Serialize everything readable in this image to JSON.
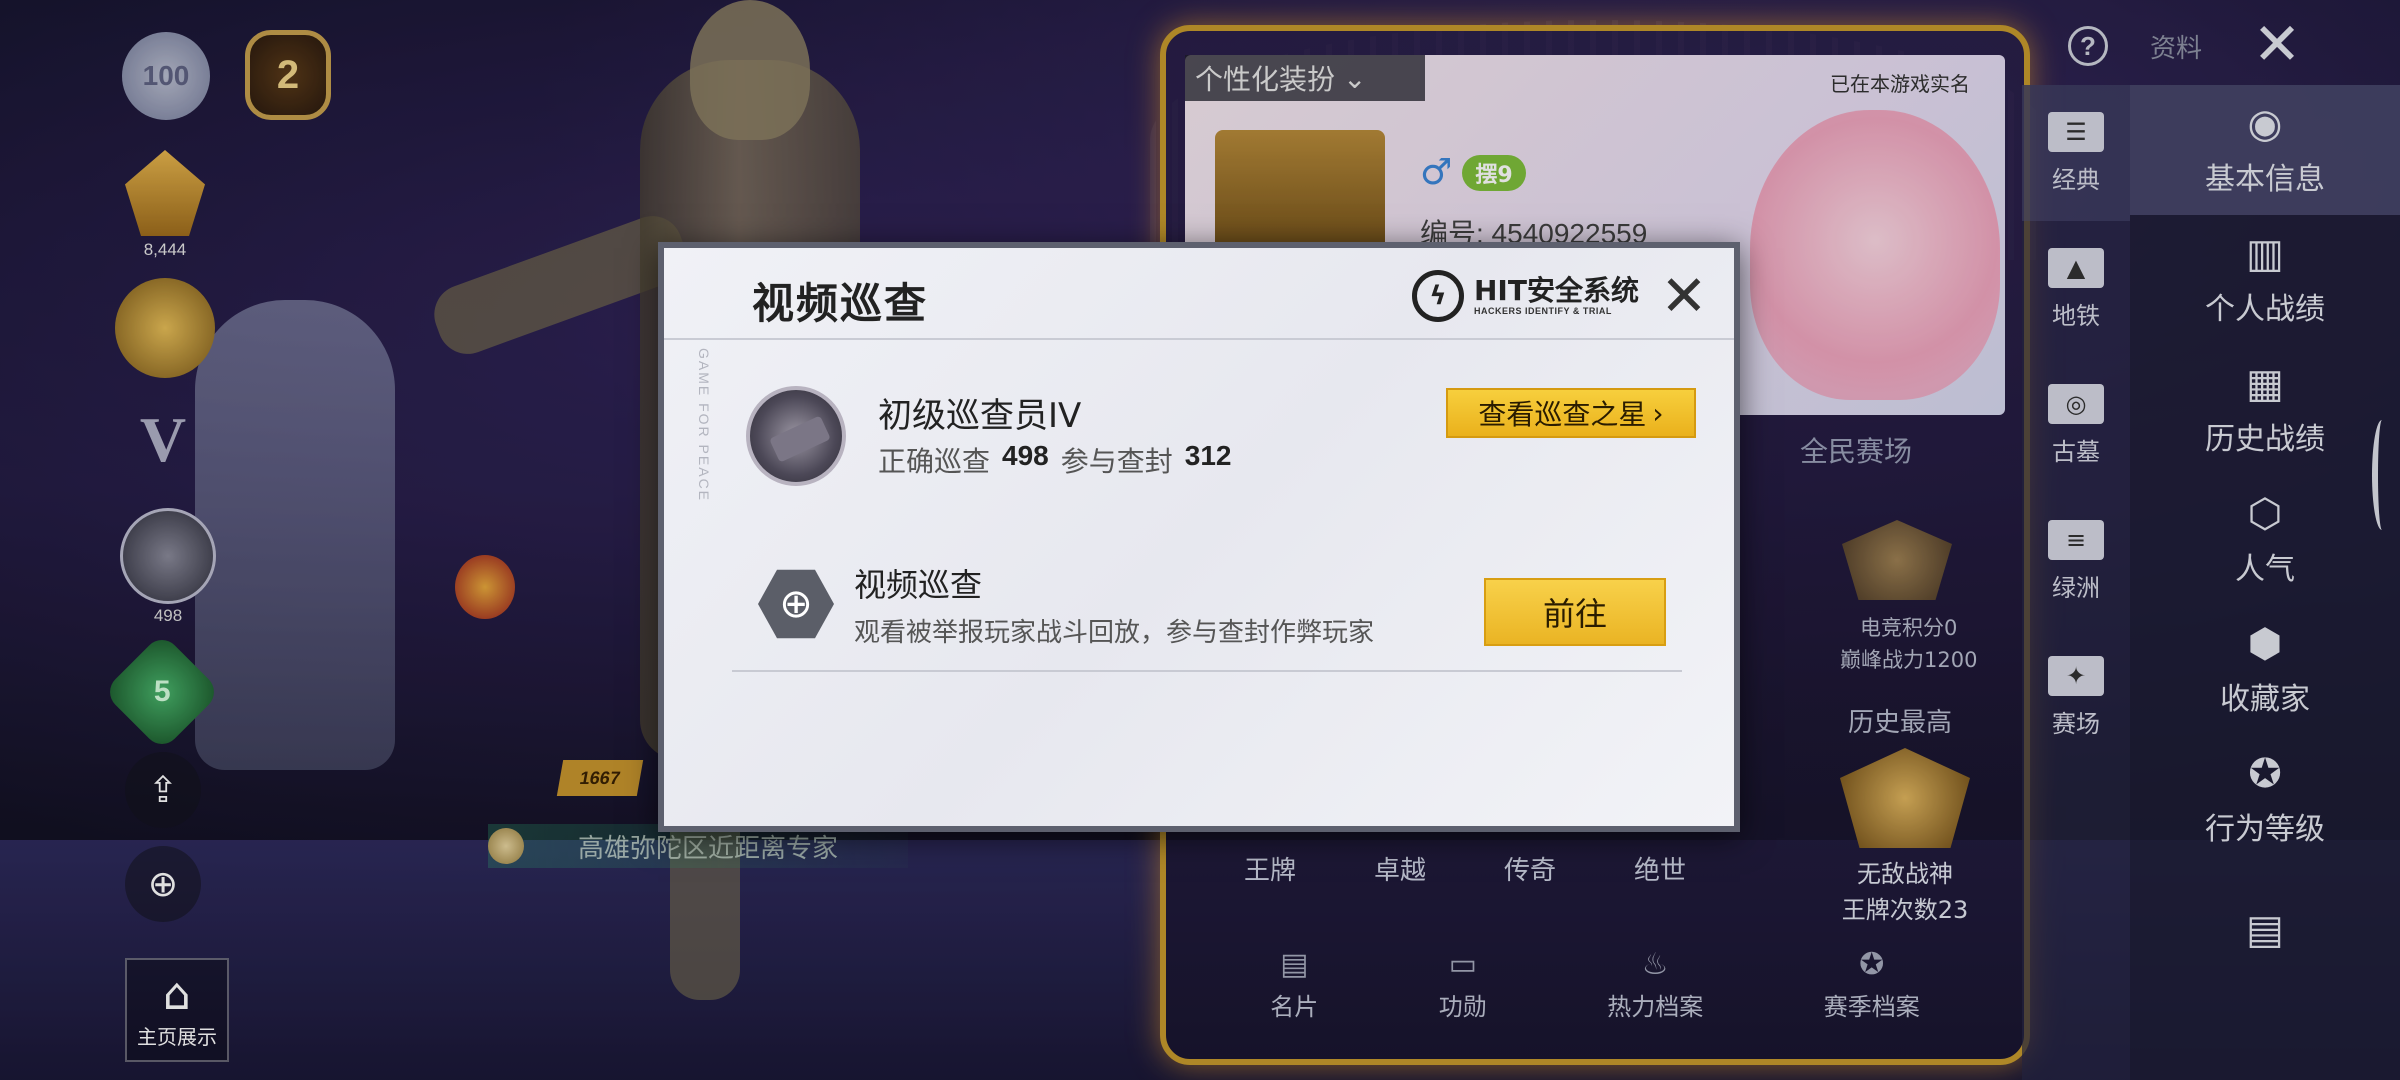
{
  "left_hud": {
    "badge_top": "100",
    "level": "2",
    "rank_num": "8,444",
    "patrol_count": "498",
    "green_badge": "5",
    "home_display_label": "主页展示",
    "highlight_label": "高雄弥陀区近距离专家",
    "flag_value": "1667"
  },
  "top_right": {
    "help_icon": "question-icon",
    "profile_label": "资料",
    "close_icon": "close-icon"
  },
  "profile": {
    "custom_tab": "个性化装扮",
    "realname_note": "已在本游戏实名",
    "badge": "摆9",
    "player_id": "编号: 4540922559",
    "season_title": "全民赛场",
    "esports_score": "电竞积分0",
    "peak_power": "巅峰战力1200",
    "history_title": "历史最高",
    "history_rank": "无敌战神",
    "ace_count": "王牌次数23",
    "tiers": [
      "王牌",
      "卓越",
      "传奇",
      "绝世"
    ],
    "bottom_tabs": [
      {
        "label": "名片",
        "icon": "card-icon"
      },
      {
        "label": "功勋",
        "icon": "medal-icon"
      },
      {
        "label": "热力档案",
        "icon": "flame-icon"
      },
      {
        "label": "赛季档案",
        "icon": "season-icon"
      }
    ]
  },
  "sidebar_modes": [
    {
      "label": "经典",
      "icon": "classic-icon",
      "active": true
    },
    {
      "label": "地铁",
      "icon": "metro-icon"
    },
    {
      "label": "古墓",
      "icon": "tomb-icon"
    },
    {
      "label": "绿洲",
      "icon": "oasis-icon"
    },
    {
      "label": "赛场",
      "icon": "arena-icon"
    }
  ],
  "sidebar_menu": [
    {
      "label": "基本信息",
      "icon": "user-info-icon",
      "active": true
    },
    {
      "label": "个人战绩",
      "icon": "stats-icon"
    },
    {
      "label": "历史战绩",
      "icon": "history-icon"
    },
    {
      "label": "人气",
      "icon": "popularity-icon"
    },
    {
      "label": "收藏家",
      "icon": "collector-icon"
    },
    {
      "label": "行为等级",
      "icon": "behavior-icon"
    },
    {
      "label": "",
      "icon": "notes-icon"
    }
  ],
  "modal": {
    "title": "视频巡查",
    "logo_main": "HIT安全系统",
    "logo_sub": "HACKERS IDENTIFY & TRIAL",
    "rank_title": "初级巡查员IV",
    "correct_label": "正确巡查",
    "correct_value": "498",
    "join_label": "参与查封",
    "join_value": "312",
    "star_button": "查看巡查之星",
    "patrol_title": "视频巡查",
    "patrol_desc": "观看被举报玩家战斗回放，参与查封作弊玩家",
    "go_button": "前往",
    "watermark": "GAME FOR PEACE"
  },
  "colors": {
    "accent_gold": "#f5c531",
    "frame_gold": "#c79a2d",
    "modal_bg": "#ecedf2"
  }
}
